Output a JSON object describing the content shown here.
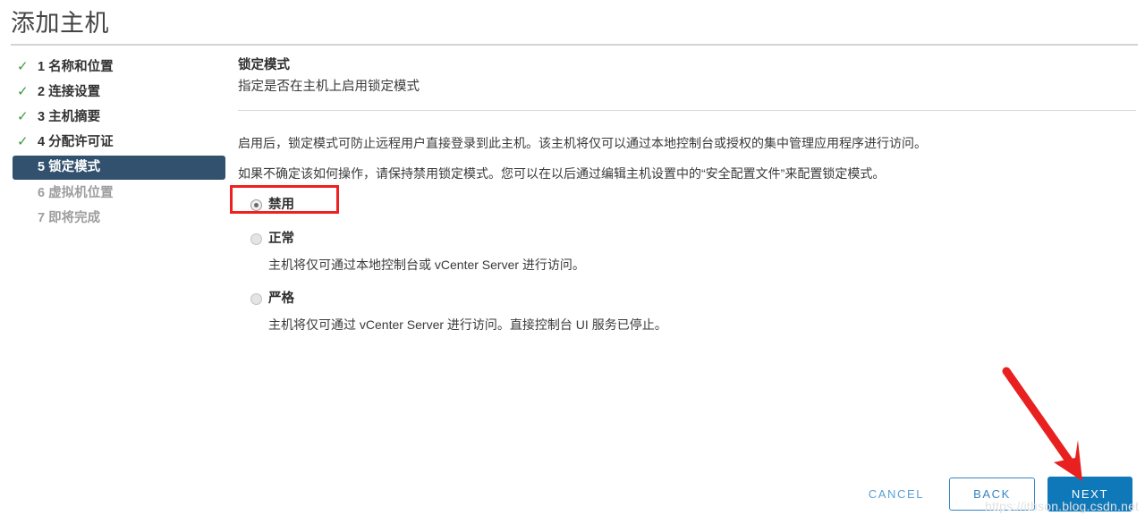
{
  "window": {
    "title": "添加主机"
  },
  "steps": [
    {
      "number": "1",
      "label": "名称和位置",
      "state": "done",
      "icon": "check-icon"
    },
    {
      "number": "2",
      "label": "连接设置",
      "state": "done",
      "icon": "check-icon"
    },
    {
      "number": "3",
      "label": "主机摘要",
      "state": "done",
      "icon": "check-icon"
    },
    {
      "number": "4",
      "label": "分配许可证",
      "state": "done",
      "icon": "check-icon"
    },
    {
      "number": "5",
      "label": "锁定模式",
      "state": "active",
      "icon": ""
    },
    {
      "number": "6",
      "label": "虚拟机位置",
      "state": "pending",
      "icon": ""
    },
    {
      "number": "7",
      "label": "即将完成",
      "state": "pending",
      "icon": ""
    }
  ],
  "panel": {
    "title": "锁定模式",
    "subtitle": "指定是否在主机上启用锁定模式",
    "paragraph1": "启用后，锁定模式可防止远程用户直接登录到此主机。该主机将仅可以通过本地控制台或授权的集中管理应用程序进行访问。",
    "paragraph2": "如果不确定该如何操作，请保持禁用锁定模式。您可以在以后通过编辑主机设置中的“安全配置文件”来配置锁定模式。",
    "options": [
      {
        "label": "禁用",
        "description": "",
        "selected": true
      },
      {
        "label": "正常",
        "description": "主机将仅可通过本地控制台或 vCenter Server 进行访问。",
        "selected": false
      },
      {
        "label": "严格",
        "description": "主机将仅可通过 vCenter Server 进行访问。直接控制台 UI 服务已停止。",
        "selected": false
      }
    ]
  },
  "footer": {
    "cancel_label": "CANCEL",
    "back_label": "BACK",
    "next_label": "NEXT"
  },
  "annotations": {
    "highlight_color": "#ef2020",
    "arrow_color": "#e8201f",
    "watermark_text": "https://ithson.blog.csdn.net"
  },
  "colors": {
    "active_step_bg": "#31516e",
    "check_green": "#3c9a3c",
    "primary_button": "#0e78b8",
    "link_blue": "#5aa0d6"
  }
}
